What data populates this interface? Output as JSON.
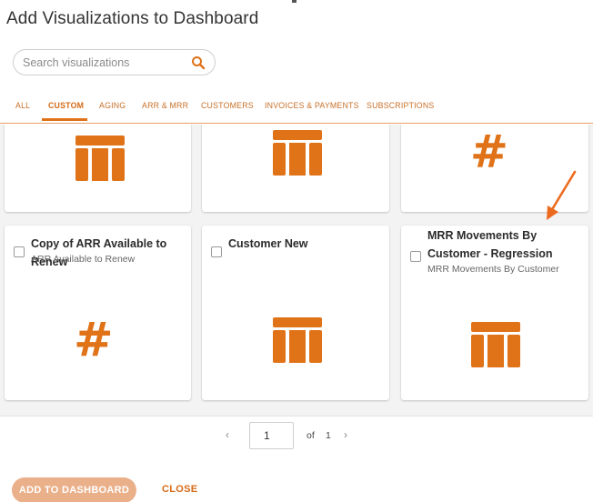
{
  "dialog": {
    "title": "Add Visualizations to Dashboard"
  },
  "search": {
    "placeholder": "Search visualizations",
    "value": ""
  },
  "tabs": [
    {
      "label": "ALL",
      "active": false
    },
    {
      "label": "CUSTOM",
      "active": true
    },
    {
      "label": "AGING",
      "active": false
    },
    {
      "label": "ARR & MRR",
      "active": false
    },
    {
      "label": "CUSTOMERS",
      "active": false
    },
    {
      "label": "INVOICES & PAYMENTS",
      "active": false
    },
    {
      "label": "SUBSCRIPTIONS",
      "active": false
    }
  ],
  "cards": [
    {
      "title": "",
      "subtitle": "",
      "icon": "table-icon"
    },
    {
      "title": "",
      "subtitle": "",
      "icon": "table-icon"
    },
    {
      "title": "",
      "subtitle": "",
      "icon": "hash-icon"
    },
    {
      "title": "Copy of ARR Available to Renew",
      "subtitle": "ARR Available to Renew",
      "icon": "hash-icon"
    },
    {
      "title": "Customer New",
      "subtitle": "",
      "icon": "table-icon"
    },
    {
      "title": "MRR Movements By Customer - Regression",
      "subtitle": "MRR Movements By Customer",
      "icon": "table-icon"
    }
  ],
  "pagination": {
    "current": "1",
    "of_label": "of",
    "total": "1"
  },
  "actions": {
    "add_label": "ADD TO DASHBOARD",
    "close_label": "CLOSE"
  },
  "colors": {
    "accent": "#e07218",
    "accent_light": "#eab08a",
    "tab_text": "#c8712a"
  }
}
